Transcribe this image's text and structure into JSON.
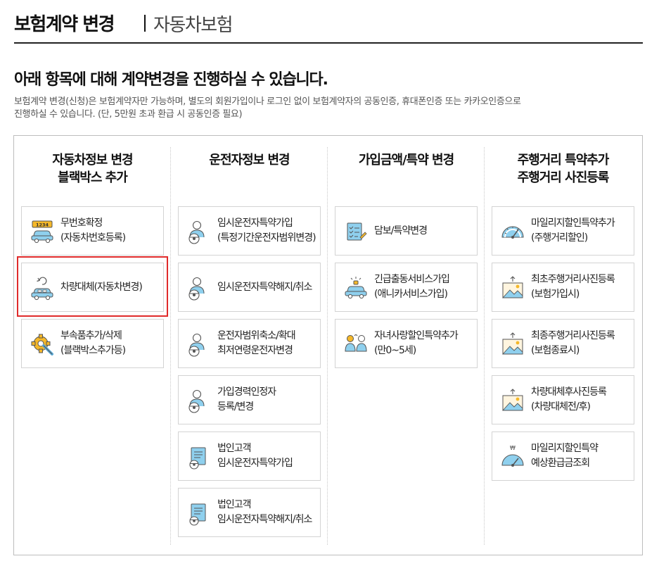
{
  "header": {
    "title": "보험계약 변경",
    "subtitle": "자동차보험"
  },
  "intro": {
    "headline": "아래 항목에 대해 계약변경을 진행하실 수 있습니다.",
    "line1": "보험계약 변경(신청)은 보험계약자만 가능하며, 별도의 회원가입이나 로그인 없이 보험계약자의 공동인증, 휴대폰인증 또는 카카오인증으로",
    "line2": "진행하실 수 있습니다. (단, 5만원 초과 환급 시 공동인증 필요)"
  },
  "columns": [
    {
      "title1": "자동차정보 변경",
      "title2": "블랙박스 추가",
      "items": [
        {
          "line1": "무번호확정",
          "line2": "(자동차번호등록)",
          "icon": "car-plate-icon",
          "plate_text": "1234"
        },
        {
          "line1": "차량대체(자동차변경)",
          "line2": "",
          "icon": "car-replace-icon"
        },
        {
          "line1": "부속품추가/삭제",
          "line2": "(블랙박스추가등)",
          "icon": "gear-wrench-icon"
        }
      ]
    },
    {
      "title1": "운전자정보 변경",
      "title2": "",
      "items": [
        {
          "line1": "임시운전자특약가입",
          "line2": "(특정기간운전자범위변경)",
          "icon": "driver-clock-icon"
        },
        {
          "line1": "임시운전자특약해지/취소",
          "line2": "",
          "icon": "driver-cancel-icon"
        },
        {
          "line1": "운전자범위축소/확대",
          "line2": "최저연령운전자변경",
          "icon": "driver-scope-icon"
        },
        {
          "line1": "가입경력인정자",
          "line2": "등록/변경",
          "icon": "driver-gear-icon"
        },
        {
          "line1": "법인고객",
          "line2": "임시운전자특약가입",
          "icon": "document-clock-icon"
        },
        {
          "line1": "법인고객",
          "line2": "임시운전자특약해지/취소",
          "icon": "document-cancel-icon"
        }
      ]
    },
    {
      "title1": "가입금액/특약 변경",
      "title2": "",
      "items": [
        {
          "line1": "담보/특약변경",
          "line2": "",
          "icon": "checklist-edit-icon"
        },
        {
          "line1": "긴급출동서비스가입",
          "line2": "(애니카서비스가입)",
          "icon": "emergency-car-icon"
        },
        {
          "line1": "자녀사랑할인특약추가",
          "line2": "(만0~5세)",
          "icon": "family-icon"
        }
      ]
    },
    {
      "title1": "주행거리 특약추가",
      "title2": "주행거리 사진등록",
      "items": [
        {
          "line1": "마일리지할인특약추가",
          "line2": "(주행거리할인)",
          "icon": "speedometer-icon"
        },
        {
          "line1": "최초주행거리사진등록",
          "line2": "(보험가입시)",
          "icon": "photo-upload-icon"
        },
        {
          "line1": "최종주행거리사진등록",
          "line2": "(보험종료시)",
          "icon": "photo-upload-icon"
        },
        {
          "line1": "차량대체후사진등록",
          "line2": "(차량대체전/후)",
          "icon": "photo-upload-icon"
        },
        {
          "line1": "마일리지할인특약",
          "line2": "예상환급금조회",
          "icon": "refund-speedometer-icon"
        }
      ]
    }
  ],
  "colors": {
    "accent_yellow": "#f5b829",
    "accent_blue": "#7fc6e8",
    "highlight_red": "#e02b2b"
  }
}
